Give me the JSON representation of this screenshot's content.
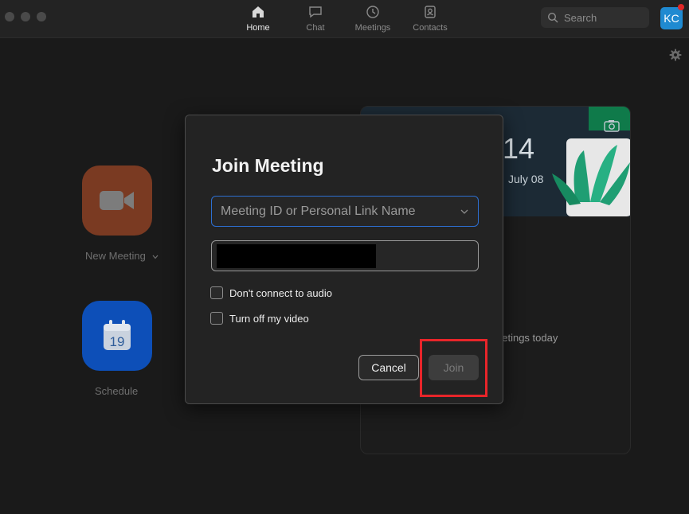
{
  "nav": {
    "tabs": [
      {
        "label": "Home",
        "icon": "home-icon",
        "active": true
      },
      {
        "label": "Chat",
        "icon": "chat-icon",
        "active": false
      },
      {
        "label": "Meetings",
        "icon": "clock-icon",
        "active": false
      },
      {
        "label": "Contacts",
        "icon": "contacts-icon",
        "active": false
      }
    ],
    "search_placeholder": "Search",
    "avatar_initials": "KC"
  },
  "home": {
    "new_meeting_label": "New Meeting",
    "schedule_label": "Schedule",
    "schedule_day": "19"
  },
  "card": {
    "time_fragment": "14",
    "date_fragment": "July 08",
    "message_fragment": "eetings today"
  },
  "dialog": {
    "title": "Join Meeting",
    "meeting_id_placeholder": "Meeting ID or Personal Link Name",
    "name_value": "",
    "options": [
      {
        "label": "Don't connect to audio",
        "checked": false
      },
      {
        "label": "Turn off my video",
        "checked": false
      }
    ],
    "cancel_label": "Cancel",
    "join_label": "Join",
    "join_enabled": false
  },
  "colors": {
    "accent": "#2d6fd1",
    "highlight": "#e8252a",
    "avatar": "#1f8ad1"
  }
}
